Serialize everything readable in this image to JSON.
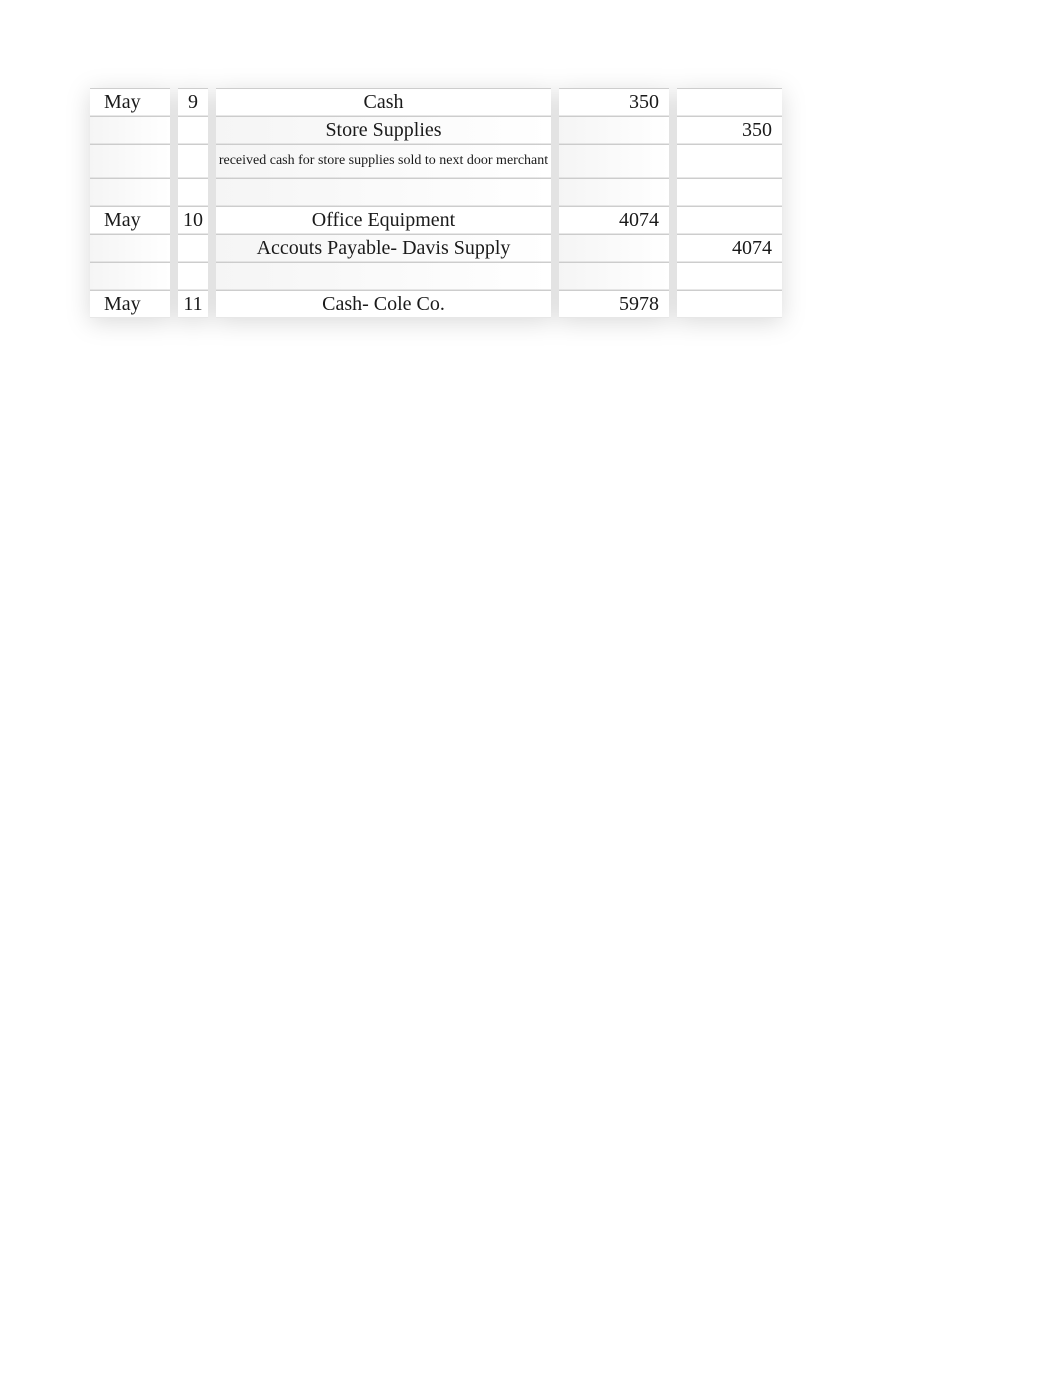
{
  "journal": {
    "rows": [
      {
        "month": "May",
        "day": "9",
        "description": "Cash",
        "debit": "350",
        "credit": ""
      },
      {
        "month": "",
        "day": "",
        "description": "Store Supplies",
        "debit": "",
        "credit": "350"
      },
      {
        "month": "",
        "day": "",
        "description": "received cash for store supplies sold to next door merchant",
        "debit": "",
        "credit": "",
        "note": true
      },
      {
        "month": "",
        "day": "",
        "description": "",
        "debit": "",
        "credit": ""
      },
      {
        "month": "May",
        "day": "10",
        "description": "Office Equipment",
        "debit": "4074",
        "credit": ""
      },
      {
        "month": "",
        "day": "",
        "description": "Accouts Payable- Davis Supply",
        "debit": "",
        "credit": "4074"
      },
      {
        "month": "",
        "day": "",
        "description": "",
        "debit": "",
        "credit": ""
      },
      {
        "month": "May",
        "day": "11",
        "description": "Cash- Cole Co.",
        "debit": "5978",
        "credit": ""
      }
    ]
  }
}
